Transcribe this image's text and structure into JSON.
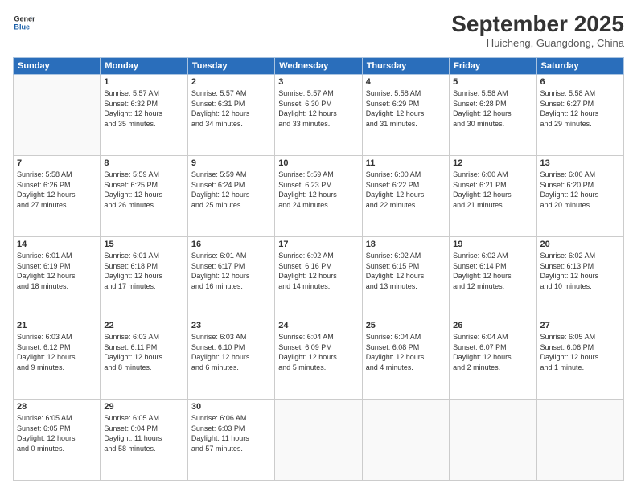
{
  "logo": {
    "line1": "General",
    "line2": "Blue"
  },
  "title": "September 2025",
  "location": "Huicheng, Guangdong, China",
  "days_of_week": [
    "Sunday",
    "Monday",
    "Tuesday",
    "Wednesday",
    "Thursday",
    "Friday",
    "Saturday"
  ],
  "weeks": [
    [
      {
        "day": "",
        "text": ""
      },
      {
        "day": "1",
        "text": "Sunrise: 5:57 AM\nSunset: 6:32 PM\nDaylight: 12 hours\nand 35 minutes."
      },
      {
        "day": "2",
        "text": "Sunrise: 5:57 AM\nSunset: 6:31 PM\nDaylight: 12 hours\nand 34 minutes."
      },
      {
        "day": "3",
        "text": "Sunrise: 5:57 AM\nSunset: 6:30 PM\nDaylight: 12 hours\nand 33 minutes."
      },
      {
        "day": "4",
        "text": "Sunrise: 5:58 AM\nSunset: 6:29 PM\nDaylight: 12 hours\nand 31 minutes."
      },
      {
        "day": "5",
        "text": "Sunrise: 5:58 AM\nSunset: 6:28 PM\nDaylight: 12 hours\nand 30 minutes."
      },
      {
        "day": "6",
        "text": "Sunrise: 5:58 AM\nSunset: 6:27 PM\nDaylight: 12 hours\nand 29 minutes."
      }
    ],
    [
      {
        "day": "7",
        "text": "Sunrise: 5:58 AM\nSunset: 6:26 PM\nDaylight: 12 hours\nand 27 minutes."
      },
      {
        "day": "8",
        "text": "Sunrise: 5:59 AM\nSunset: 6:25 PM\nDaylight: 12 hours\nand 26 minutes."
      },
      {
        "day": "9",
        "text": "Sunrise: 5:59 AM\nSunset: 6:24 PM\nDaylight: 12 hours\nand 25 minutes."
      },
      {
        "day": "10",
        "text": "Sunrise: 5:59 AM\nSunset: 6:23 PM\nDaylight: 12 hours\nand 24 minutes."
      },
      {
        "day": "11",
        "text": "Sunrise: 6:00 AM\nSunset: 6:22 PM\nDaylight: 12 hours\nand 22 minutes."
      },
      {
        "day": "12",
        "text": "Sunrise: 6:00 AM\nSunset: 6:21 PM\nDaylight: 12 hours\nand 21 minutes."
      },
      {
        "day": "13",
        "text": "Sunrise: 6:00 AM\nSunset: 6:20 PM\nDaylight: 12 hours\nand 20 minutes."
      }
    ],
    [
      {
        "day": "14",
        "text": "Sunrise: 6:01 AM\nSunset: 6:19 PM\nDaylight: 12 hours\nand 18 minutes."
      },
      {
        "day": "15",
        "text": "Sunrise: 6:01 AM\nSunset: 6:18 PM\nDaylight: 12 hours\nand 17 minutes."
      },
      {
        "day": "16",
        "text": "Sunrise: 6:01 AM\nSunset: 6:17 PM\nDaylight: 12 hours\nand 16 minutes."
      },
      {
        "day": "17",
        "text": "Sunrise: 6:02 AM\nSunset: 6:16 PM\nDaylight: 12 hours\nand 14 minutes."
      },
      {
        "day": "18",
        "text": "Sunrise: 6:02 AM\nSunset: 6:15 PM\nDaylight: 12 hours\nand 13 minutes."
      },
      {
        "day": "19",
        "text": "Sunrise: 6:02 AM\nSunset: 6:14 PM\nDaylight: 12 hours\nand 12 minutes."
      },
      {
        "day": "20",
        "text": "Sunrise: 6:02 AM\nSunset: 6:13 PM\nDaylight: 12 hours\nand 10 minutes."
      }
    ],
    [
      {
        "day": "21",
        "text": "Sunrise: 6:03 AM\nSunset: 6:12 PM\nDaylight: 12 hours\nand 9 minutes."
      },
      {
        "day": "22",
        "text": "Sunrise: 6:03 AM\nSunset: 6:11 PM\nDaylight: 12 hours\nand 8 minutes."
      },
      {
        "day": "23",
        "text": "Sunrise: 6:03 AM\nSunset: 6:10 PM\nDaylight: 12 hours\nand 6 minutes."
      },
      {
        "day": "24",
        "text": "Sunrise: 6:04 AM\nSunset: 6:09 PM\nDaylight: 12 hours\nand 5 minutes."
      },
      {
        "day": "25",
        "text": "Sunrise: 6:04 AM\nSunset: 6:08 PM\nDaylight: 12 hours\nand 4 minutes."
      },
      {
        "day": "26",
        "text": "Sunrise: 6:04 AM\nSunset: 6:07 PM\nDaylight: 12 hours\nand 2 minutes."
      },
      {
        "day": "27",
        "text": "Sunrise: 6:05 AM\nSunset: 6:06 PM\nDaylight: 12 hours\nand 1 minute."
      }
    ],
    [
      {
        "day": "28",
        "text": "Sunrise: 6:05 AM\nSunset: 6:05 PM\nDaylight: 12 hours\nand 0 minutes."
      },
      {
        "day": "29",
        "text": "Sunrise: 6:05 AM\nSunset: 6:04 PM\nDaylight: 11 hours\nand 58 minutes."
      },
      {
        "day": "30",
        "text": "Sunrise: 6:06 AM\nSunset: 6:03 PM\nDaylight: 11 hours\nand 57 minutes."
      },
      {
        "day": "",
        "text": ""
      },
      {
        "day": "",
        "text": ""
      },
      {
        "day": "",
        "text": ""
      },
      {
        "day": "",
        "text": ""
      }
    ]
  ]
}
